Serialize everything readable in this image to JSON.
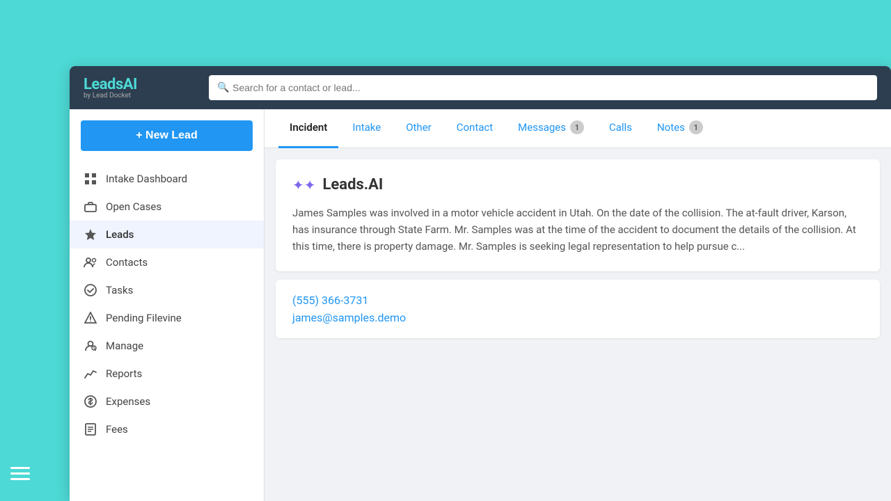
{
  "logo": {
    "brand": "Leads",
    "brand_accent": "AI",
    "sub": "by Lead Docket"
  },
  "search": {
    "placeholder": "Search for a contact or lead..."
  },
  "sidebar": {
    "new_lead_label": "+ New Lead",
    "items": [
      {
        "id": "intake-dashboard",
        "label": "Intake Dashboard",
        "icon": "grid"
      },
      {
        "id": "open-cases",
        "label": "Open Cases",
        "icon": "briefcase"
      },
      {
        "id": "leads",
        "label": "Leads",
        "icon": "star",
        "active": true
      },
      {
        "id": "contacts",
        "label": "Contacts",
        "icon": "people"
      },
      {
        "id": "tasks",
        "label": "Tasks",
        "icon": "check-circle"
      },
      {
        "id": "pending-filevine",
        "label": "Pending Filevine",
        "icon": "warning"
      },
      {
        "id": "manage",
        "label": "Manage",
        "icon": "person-gear"
      },
      {
        "id": "reports",
        "label": "Reports",
        "icon": "chart"
      },
      {
        "id": "expenses",
        "label": "Expenses",
        "icon": "dollar"
      },
      {
        "id": "fees",
        "label": "Fees",
        "icon": "receipt"
      }
    ]
  },
  "tabs": [
    {
      "id": "incident",
      "label": "Incident",
      "active": true,
      "badge": null
    },
    {
      "id": "intake",
      "label": "Intake",
      "active": false,
      "badge": null
    },
    {
      "id": "other",
      "label": "Other",
      "active": false,
      "badge": null
    },
    {
      "id": "contact",
      "label": "Contact",
      "active": false,
      "badge": null
    },
    {
      "id": "messages",
      "label": "Messages",
      "active": false,
      "badge": "1"
    },
    {
      "id": "calls",
      "label": "Calls",
      "active": false,
      "badge": null
    },
    {
      "id": "notes",
      "label": "Notes",
      "active": false,
      "badge": "1"
    }
  ],
  "ai_section": {
    "title": "Leads.AI",
    "description": "James Samples was involved in a motor vehicle accident in Utah. On the date of the collision. The at-fault driver, Karson, has insurance through State Farm. Mr. Samples was at the time of the accident to document the details of the collision. At this time, there is property damage. Mr. Samples is seeking legal representation to help pursue c..."
  },
  "contact_section": {
    "phone": "(555) 366-3731",
    "email": "james@samples.demo"
  },
  "colors": {
    "accent": "#2196f3",
    "ai_purple": "#7b68ee",
    "active_tab_underline": "#2196f3"
  }
}
